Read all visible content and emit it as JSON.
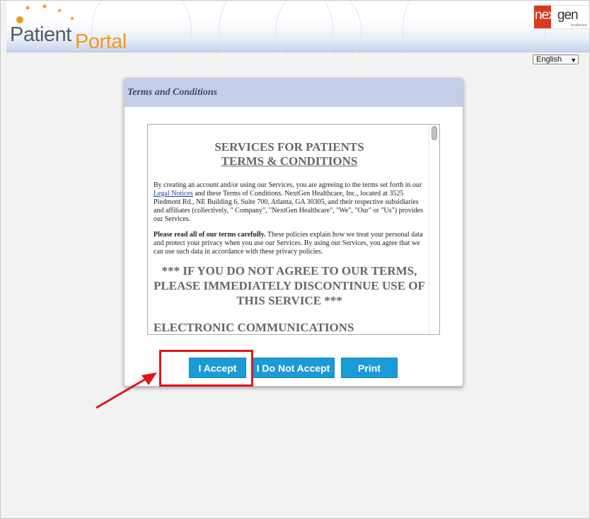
{
  "header": {
    "logo_patient": "Patient",
    "logo_portal": "Portal",
    "brand_next": "next",
    "brand_gen": "gen",
    "brand_sub": "healthcare"
  },
  "language": {
    "selected": "English"
  },
  "dialog": {
    "title": "Terms and Conditions",
    "terms": {
      "heading": "SERVICES FOR PATIENTS",
      "subheading": "TERMS & CONDITIONS",
      "para1_before_link": "By creating an account and/or using our Services, you are agreeing to the terms set forth in our ",
      "para1_link": "Legal Notices",
      "para1_after_link": " and these Terms of Conditions. NextGen Healthcare, Inc., located at 3525 Piedmont Rd., NE Building 6, Suite 700, Atlanta, GA 30305, and their respective subsidiaries and affiliates (collectively, \" Company\", \"NextGen Healthcare\", \"We\", \"Our\" or \"Us\") provides our Services.",
      "para2_bold": "Please read all of our terms carefully.",
      "para2_rest": " These policies explain how we treat your personal data and protect your privacy when you use our Services. By using our Services, you agree that we can use such data in accordance with these privacy policies.",
      "warning": "*** IF YOU DO NOT AGREE TO OUR TERMS, PLEASE IMMEDIATELY DISCONTINUE USE OF THIS SERVICE ***",
      "section_heading": "ELECTRONIC COMMUNICATIONS"
    },
    "buttons": {
      "accept": "I Accept",
      "decline": "I Do Not Accept",
      "print": "Print"
    }
  },
  "colors": {
    "accent_button": "#1a9ad6",
    "header_band": "#c5cde8",
    "highlight": "#e0151a",
    "logo_orange": "#f39a21"
  },
  "icons": [
    "chevron-down-icon",
    "arrow-annotation-icon",
    "scroll-thumb"
  ]
}
